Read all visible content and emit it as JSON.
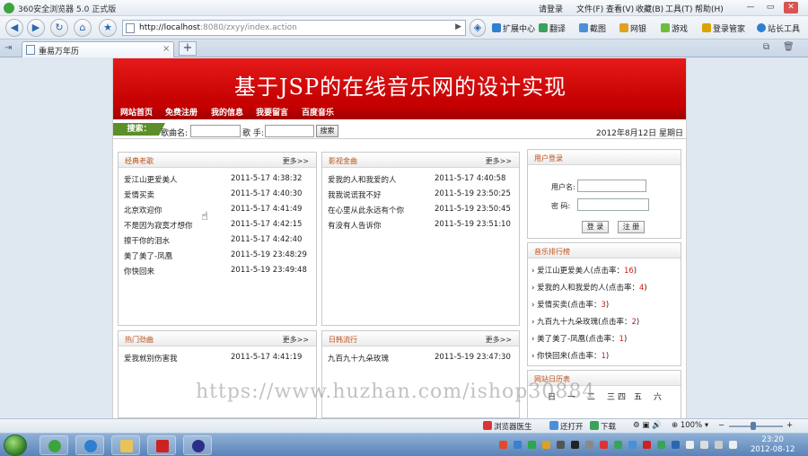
{
  "browser": {
    "title": "360安全浏览器 5.0 正式版",
    "login": "请登录",
    "menus": [
      "文件(F)",
      "查看(V)",
      "收藏(B)",
      "工具(T)",
      "帮助(H)"
    ],
    "url_host": "http://localhost",
    "url_path": ":8080/zxyy/index.action",
    "tools": [
      "扩展中心",
      "翻译",
      "截图",
      "网银",
      "游戏",
      "登录管家",
      "站长工具"
    ],
    "tab_title": "重易万年历",
    "status": {
      "left": "浏览器医生",
      "open": "还打开",
      "download": "下载",
      "zoom": "100%"
    }
  },
  "site": {
    "banner_title": "基于JSP的在线音乐网的设计实现",
    "nav": [
      "网站首页",
      "免费注册",
      "我的信息",
      "我要留言",
      "百度音乐"
    ],
    "search": {
      "tag": "搜索：",
      "song_label": "歌曲名:",
      "singer_label": "歌 手:",
      "button": "搜索"
    },
    "date": "2012年8月12日  星期日",
    "more": "更多>>",
    "boxes": {
      "classic": {
        "title": "经典老歌",
        "rows": [
          {
            "name": "爱江山更爱美人",
            "date": "2011-5-17 4:38:32"
          },
          {
            "name": "爱情买卖",
            "date": "2011-5-17 4:40:30"
          },
          {
            "name": "北京欢迎你",
            "date": "2011-5-17 4:41:49"
          },
          {
            "name": "不是因为寂寞才想你",
            "date": "2011-5-17 4:42:15"
          },
          {
            "name": "擦干你的泪水",
            "date": "2011-5-17 4:42:40"
          },
          {
            "name": "美了美了-凤凰",
            "date": "2011-5-19 23:48:29"
          },
          {
            "name": "你快回来",
            "date": "2011-5-19 23:49:48"
          }
        ]
      },
      "movie": {
        "title": "影视金曲",
        "rows": [
          {
            "name": "爱我的人和我爱的人",
            "date": "2011-5-17 4:40:58"
          },
          {
            "name": "我我说谎我不好",
            "date": "2011-5-19 23:50:25"
          },
          {
            "name": "在心里从此永远有个你",
            "date": "2011-5-19 23:50:45"
          },
          {
            "name": "有没有人告诉你",
            "date": "2011-5-19 23:51:10"
          }
        ]
      },
      "hot": {
        "title": "热门劲曲",
        "rows": [
          {
            "name": "爱我就别伤害我",
            "date": "2011-5-17 4:41:19"
          }
        ]
      },
      "daily": {
        "title": "日韩流行",
        "rows": [
          {
            "name": "九百九十九朵玫瑰",
            "date": "2011-5-19 23:47:30"
          }
        ]
      }
    },
    "login_box": {
      "title": "用户登录",
      "user_label": "用户名:",
      "pass_label": "密  码:",
      "login_btn": "登 录",
      "register_btn": "注 册"
    },
    "ranking": {
      "title": "音乐排行榜",
      "prefix": "点击率：",
      "items": [
        {
          "name": "爱江山更爱美人",
          "count": "16"
        },
        {
          "name": "爱我的人和我爱的人",
          "count": "4"
        },
        {
          "name": "爱情买卖",
          "count": "3"
        },
        {
          "name": "九百九十九朵玫瑰",
          "count": "2"
        },
        {
          "name": "美了美了-凤凰",
          "count": "1"
        },
        {
          "name": "你快回来",
          "count": "1"
        }
      ]
    },
    "calendar": {
      "title": "网站日历表",
      "weekdays": [
        "日",
        "一",
        "二",
        "三",
        "四",
        "五",
        "六"
      ]
    }
  },
  "watermark": "https://www.huzhan.com/ishop30884",
  "clock": {
    "time": "23:20",
    "date": "2012-08-12"
  },
  "colors": {
    "banner": "#d40000",
    "nav": "#b00000",
    "accent_orange": "#c0501a",
    "rank_red": "#d81818"
  }
}
